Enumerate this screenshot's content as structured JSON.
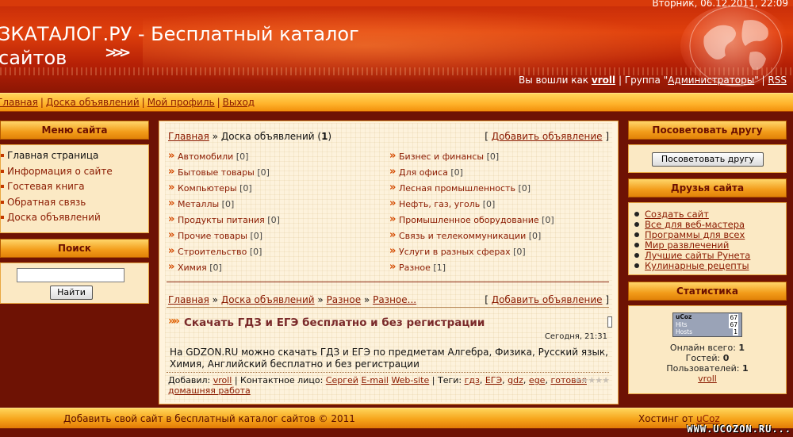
{
  "header": {
    "date": "Вторник, 06.12.2011, 22:09",
    "title_line1": "ЗКАТАЛОГ.РУ - Бесплатный каталог",
    "title_line2": "сайтов",
    "login_prefix": "Вы вошли как",
    "username": "vroll",
    "group_prefix": "| Группа \"",
    "group": "Администраторы",
    "group_suffix": "\" |",
    "rss": "RSS"
  },
  "nav": [
    "Главная",
    "Доска объявлений",
    "Мой профиль",
    "Выход"
  ],
  "menu": {
    "title": "Меню сайта",
    "items": [
      "Главная страница",
      "Информация о сайте",
      "Гостевая книга",
      "Обратная связь",
      "Доска объявлений"
    ]
  },
  "search": {
    "title": "Поиск",
    "button": "Найти"
  },
  "recommend": {
    "title": "Посоветовать другу",
    "button": "Посоветовать другу"
  },
  "friends": {
    "title": "Друзья сайта",
    "items": [
      "Создать сайт",
      "Все для веб-мастера",
      "Программы для всех",
      "Мир развлечений",
      "Лучшие сайты Рунета",
      "Кулинарные рецепты"
    ]
  },
  "stats": {
    "title": "Статистика",
    "counter_brand": "uCoz",
    "counter_top": "67",
    "hits_label": "Hits",
    "hits": "67",
    "hosts_label": "Hosts",
    "hosts": "1",
    "online_label": "Онлайн всего:",
    "online": "1",
    "guests_label": "Гостей:",
    "guests": "0",
    "users_label": "Пользователей:",
    "users": "1",
    "user": "vroll"
  },
  "main": {
    "crumb_home": "Главная",
    "crumb_board": "» Доска объявлений (",
    "crumb_count": "1",
    "crumb_close": ")",
    "add_ad": "Добавить объявление",
    "categories_left": [
      {
        "name": "Автомобили",
        "count": "[0]"
      },
      {
        "name": "Бытовые товары",
        "count": "[0]"
      },
      {
        "name": "Компьютеры",
        "count": "[0]"
      },
      {
        "name": "Металлы",
        "count": "[0]"
      },
      {
        "name": "Продукты питания",
        "count": "[0]"
      },
      {
        "name": "Прочие товары",
        "count": "[0]"
      },
      {
        "name": "Строительство",
        "count": "[0]"
      },
      {
        "name": "Химия",
        "count": "[0]"
      }
    ],
    "categories_right": [
      {
        "name": "Бизнес и финансы",
        "count": "[0]"
      },
      {
        "name": "Для офиса",
        "count": "[0]"
      },
      {
        "name": "Лесная промышленность",
        "count": "[0]"
      },
      {
        "name": "Нефть, газ, уголь",
        "count": "[0]"
      },
      {
        "name": "Промышленное оборудование",
        "count": "[0]"
      },
      {
        "name": "Связь и телекоммуникации",
        "count": "[0]"
      },
      {
        "name": "Услуги в разных сферах",
        "count": "[0]"
      },
      {
        "name": "Разное",
        "count": "[1]"
      }
    ],
    "crumbs2": [
      "Главная",
      "Доска объявлений",
      "Разное",
      "Разное..."
    ],
    "post": {
      "title": "Скачать ГДЗ и ЕГЭ бесплатно и без регистрации",
      "time": "Сегодня, 21:31",
      "body": "На GDZON.RU можно скачать ГДЗ и ЕГЭ по предметам Алгебра, Физика, Русский язык, Химия, Английский бесплатно и без регистрации",
      "added_label": "Добавил:",
      "added_by": "vroll",
      "contact_label": "| Контактное лицо:",
      "contact": "Сергей",
      "email": "E-mail",
      "website": "Web-site",
      "tags_label": "| Теги:",
      "tags": [
        "гдз",
        "ЕГЭ",
        "gdz",
        "ege",
        "готовая домашняя работа"
      ]
    }
  },
  "footer": {
    "copyright": "Добавить свой сайт в бесплатный каталог сайтов © 2011",
    "hosting_label": "Хостинг от",
    "hosting": "uCoz",
    "watermark": "WWW.UCOZON.RU..."
  }
}
